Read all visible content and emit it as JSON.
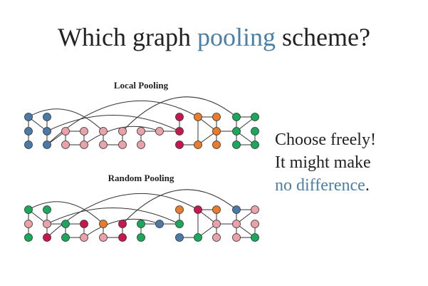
{
  "title": {
    "lead": "Which graph ",
    "highlight": "pooling",
    "tail": " scheme?"
  },
  "graph1": {
    "caption": "Local Pooling"
  },
  "graph2": {
    "caption": "Random Pooling"
  },
  "side_text": {
    "line1": "Choose freely!",
    "line2": "It might make",
    "highlight": "no difference",
    "period": "."
  },
  "colors": {
    "accent": "#4a7fa6",
    "blue": "#4a7aa8",
    "pink": "#e9a2a8",
    "crimson": "#c9164f",
    "orange": "#ea7b2a",
    "green": "#1aa85a"
  }
}
